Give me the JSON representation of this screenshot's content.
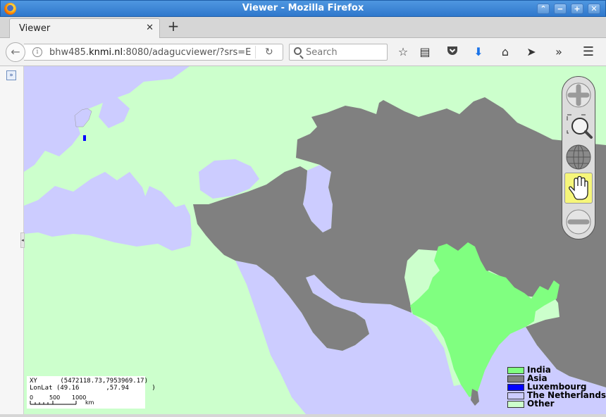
{
  "window": {
    "title": "Viewer - Mozilla Firefox"
  },
  "tabs": [
    {
      "label": "Viewer",
      "close_glyph": "✕"
    }
  ],
  "new_tab_glyph": "+",
  "url": {
    "prefix": "bhw485.",
    "domain": "knmi.nl",
    "suffix": ":8080/adagucviewer/?srs=E"
  },
  "search": {
    "placeholder": "Search"
  },
  "icons": {
    "back": "←",
    "reload": "↻",
    "bookmark": "☆",
    "reading_list": "▤",
    "pocket": "⬡",
    "download": "⬇",
    "home": "⌂",
    "send": "➤",
    "overflow": "»",
    "menu": "☰"
  },
  "coords": {
    "xy_label": "XY",
    "xy_value": "(5472118.73,7953969.17)",
    "lonlat_label": "LonLat",
    "lonlat_value": "(49.16       ,57.94      )"
  },
  "scale": {
    "ticks": [
      "0",
      "500",
      "1000"
    ],
    "unit": "km"
  },
  "legend": [
    {
      "label": "India",
      "color": "#80ff80"
    },
    {
      "label": "Asia",
      "color": "#808080"
    },
    {
      "label": "Luxembourg",
      "color": "#0000ff"
    },
    {
      "label": "The Netherlands",
      "color": "#ccccff"
    },
    {
      "label": "Other",
      "color": "#ccffcc"
    }
  ],
  "colors": {
    "sea": "#ccccff",
    "land_other": "#ccffcc",
    "asia": "#808080",
    "india": "#80ff80",
    "luxembourg": "#0000ff"
  }
}
